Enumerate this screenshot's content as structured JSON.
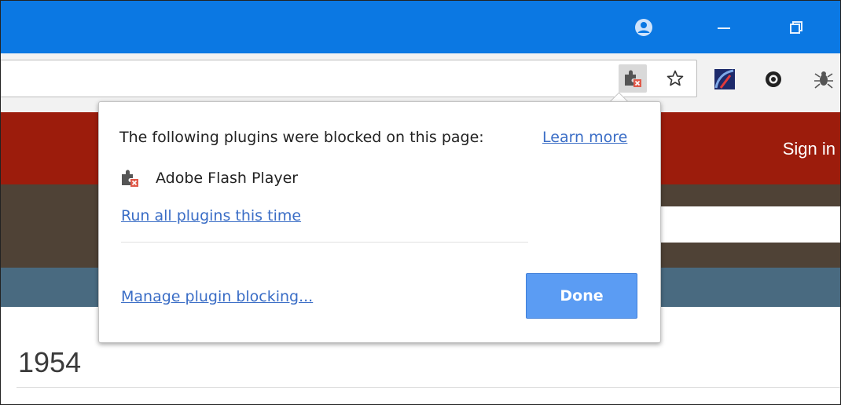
{
  "window": {
    "profile_icon": "profile-icon",
    "minimize_icon": "minimize-icon",
    "restore_icon": "restore-icon"
  },
  "toolbar": {
    "plugin_blocked_icon": "plugin-blocked-icon",
    "bookmark_icon": "star-icon",
    "extensions": [
      "extension-speed-icon",
      "extension-gear-icon",
      "extension-bug-icon"
    ]
  },
  "page": {
    "sign_in": "Sign in",
    "year": "1954"
  },
  "bubble": {
    "message": "The following plugins were blocked on this page:",
    "learn_more": "Learn more",
    "plugin_name": "Adobe Flash Player",
    "run_all": "Run all plugins this time",
    "manage": "Manage plugin blocking...",
    "done": "Done"
  },
  "colors": {
    "titlebar": "#0b78e3",
    "header_red": "#9c1c0c",
    "band_brown": "#4f4236",
    "band_slate": "#496a80",
    "link": "#3a6dc6",
    "done_button": "#5b9cf3"
  }
}
